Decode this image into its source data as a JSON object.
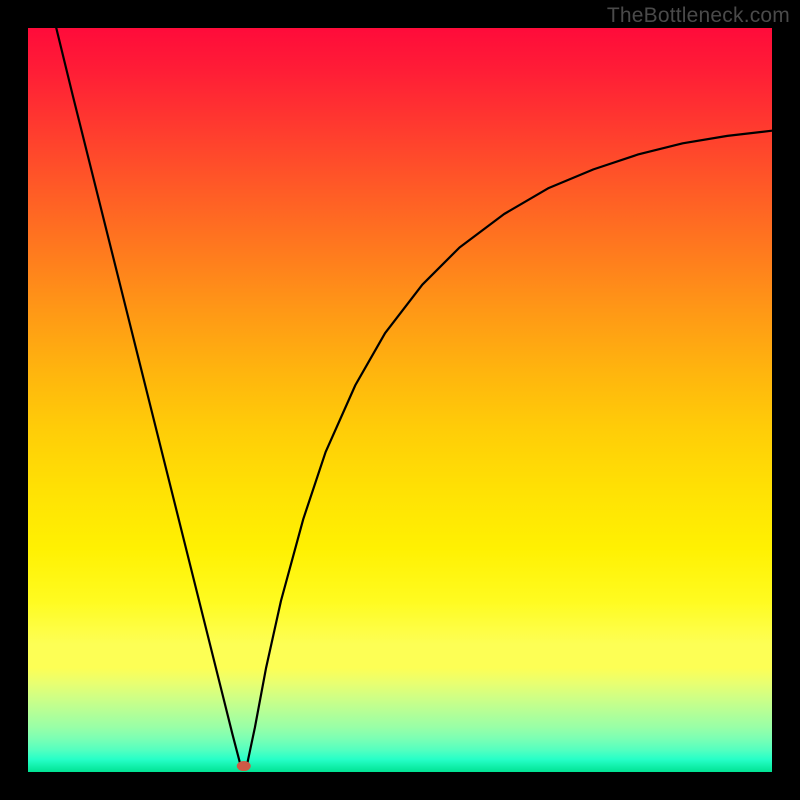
{
  "watermark": "TheBottleneck.com",
  "chart_data": {
    "type": "line",
    "title": "",
    "xlabel": "",
    "ylabel": "",
    "xlim": [
      0,
      100
    ],
    "ylim": [
      0,
      100
    ],
    "grid": false,
    "legend": false,
    "annotations": [],
    "series": [
      {
        "name": "left-branch",
        "x": [
          3.8,
          6,
          9,
          12,
          15,
          18,
          21,
          24,
          26,
          27.5,
          28.6
        ],
        "y": [
          100,
          91,
          79,
          67,
          55,
          43,
          31,
          19,
          11,
          5,
          0.8
        ]
      },
      {
        "name": "right-branch",
        "x": [
          29.4,
          30.5,
          32,
          34,
          37,
          40,
          44,
          48,
          53,
          58,
          64,
          70,
          76,
          82,
          88,
          94,
          100
        ],
        "y": [
          0.8,
          6,
          14,
          23,
          34,
          43,
          52,
          59,
          65.5,
          70.5,
          75,
          78.5,
          81,
          83,
          84.5,
          85.5,
          86.2
        ]
      }
    ],
    "marker": {
      "x": 29,
      "y": 0.8,
      "shape": "ellipse",
      "color": "#cf5a46"
    },
    "background_gradient": {
      "top": "#ff0b3a",
      "mid": "#ffe104",
      "band": "#fdff55",
      "bottom": "#00e393"
    }
  }
}
